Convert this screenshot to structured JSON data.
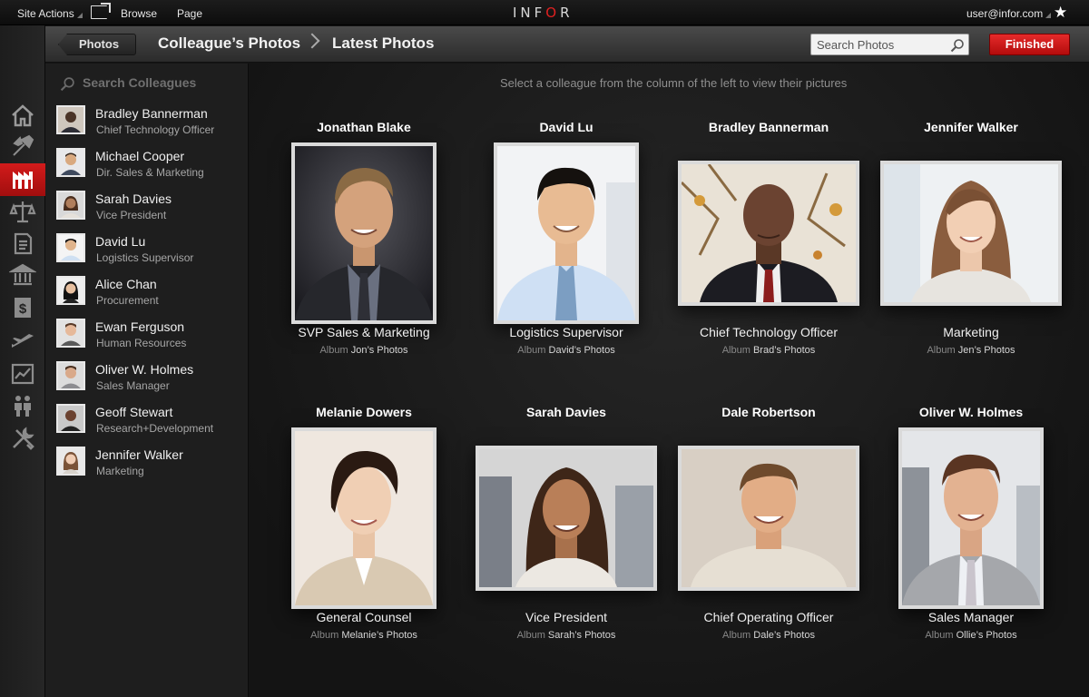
{
  "topbar": {
    "site_actions": "Site Actions",
    "browse": "Browse",
    "page": "Page",
    "brand": "INFOR",
    "user": "user@infor.com"
  },
  "header": {
    "back": "Photos",
    "crumb1": "Colleague’s Photos",
    "crumb2": "Latest Photos",
    "search_placeholder": "Search Photos",
    "finished": "Finished"
  },
  "panel": {
    "search_label": "Search Colleagues",
    "colleagues": [
      {
        "name": "Bradley Bannerman",
        "title": "Chief Technology Officer"
      },
      {
        "name": "Michael Cooper",
        "title": "Dir. Sales & Marketing"
      },
      {
        "name": "Sarah Davies",
        "title": "Vice President"
      },
      {
        "name": "David Lu",
        "title": "Logistics Supervisor"
      },
      {
        "name": "Alice Chan",
        "title": "Procurement"
      },
      {
        "name": "Ewan Ferguson",
        "title": "Human Resources"
      },
      {
        "name": "Oliver W. Holmes",
        "title": "Sales Manager"
      },
      {
        "name": "Geoff Stewart",
        "title": "Research+Development"
      },
      {
        "name": "Jennifer Walker",
        "title": "Marketing"
      }
    ]
  },
  "main": {
    "hint": "Select a colleague from the column of the left to view their pictures",
    "album_label": "Album",
    "cards": [
      {
        "name": "Jonathan Blake",
        "role": "SVP Sales & Marketing",
        "album": "Jon’s Photos"
      },
      {
        "name": "David Lu",
        "role": "Logistics Supervisor",
        "album": "David’s Photos"
      },
      {
        "name": "Bradley Bannerman",
        "role": "Chief Technology Officer",
        "album": "Brad’s Photos"
      },
      {
        "name": "Jennifer Walker",
        "role": "Marketing",
        "album": "Jen’s Photos"
      },
      {
        "name": "Melanie Dowers",
        "role": "General Counsel",
        "album": "Melanie’s Photos"
      },
      {
        "name": "Sarah Davies",
        "role": "Vice President",
        "album": "Sarah’s Photos"
      },
      {
        "name": "Dale Robertson",
        "role": "Chief Operating Officer",
        "album": "Dale’s Photos"
      },
      {
        "name": "Oliver W. Holmes",
        "role": "Sales Manager",
        "album": "Ollie’s Photos"
      }
    ]
  },
  "colors": {
    "accent": "#c8161d",
    "background": "#141414"
  }
}
